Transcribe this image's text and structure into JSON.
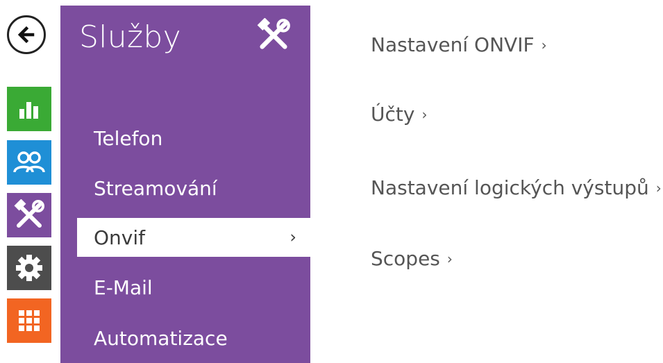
{
  "app": {
    "colors": {
      "accent_purple": "#7c4d9e",
      "tile_green": "#3aaa35",
      "tile_blue": "#1f8fd6",
      "tile_purple": "#7c4d9e",
      "tile_dark": "#4d4d4d",
      "tile_orange": "#f26522"
    }
  },
  "rail": {
    "back_icon": "back-arrow-icon",
    "tiles": [
      {
        "icon": "bar-chart-icon",
        "color": "#3aaa35"
      },
      {
        "icon": "users-icon",
        "color": "#1f8fd6"
      },
      {
        "icon": "tools-icon",
        "color": "#7c4d9e"
      },
      {
        "icon": "gear-icon",
        "color": "#4d4d4d"
      },
      {
        "icon": "grid-icon",
        "color": "#f26522"
      }
    ]
  },
  "menu": {
    "title": "Služby",
    "title_icon": "tools-icon",
    "items": [
      {
        "label": "Telefon"
      },
      {
        "label": "Streamování"
      },
      {
        "label": "Onvif",
        "chevron": "›"
      },
      {
        "label": "E-Mail"
      },
      {
        "label": "Automatizace"
      }
    ]
  },
  "content": {
    "links": [
      {
        "label": "Nastavení ONVIF",
        "chevron": "›"
      },
      {
        "label": "Účty",
        "chevron": "›"
      },
      {
        "label": "Nastavení logických výstupů",
        "chevron": "›"
      },
      {
        "label": "Scopes",
        "chevron": "›"
      }
    ]
  }
}
